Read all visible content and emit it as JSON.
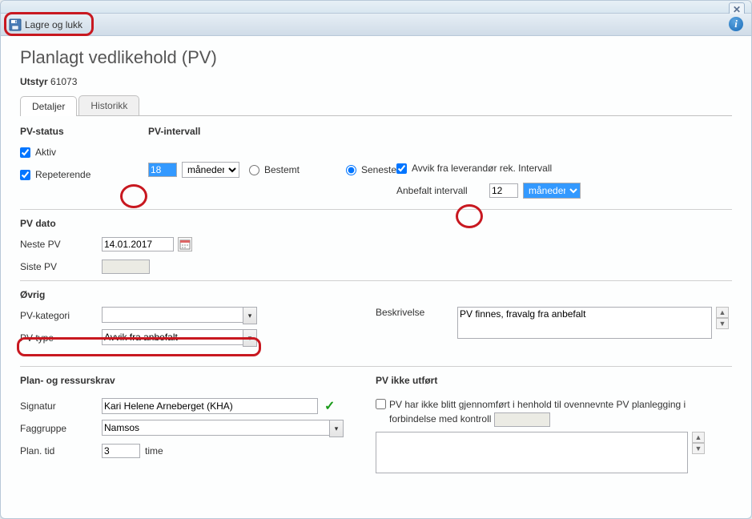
{
  "window": {
    "title": ""
  },
  "toolbar": {
    "save_label": "Lagre og lukk"
  },
  "page": {
    "heading": "Planlagt vedlikehold (PV)",
    "equipment_label": "Utstyr",
    "equipment_id": "61073"
  },
  "tabs": {
    "details": "Detaljer",
    "history": "Historikk"
  },
  "status": {
    "section": "PV-status",
    "active_label": "Aktiv",
    "active_checked": "checked",
    "repeating_label": "Repeterende",
    "repeating_checked": "checked"
  },
  "interval": {
    "section": "PV-intervall",
    "value": "18",
    "unit_options": "måneder",
    "fixed_label": "Bestemt",
    "latest_label": "Seneste",
    "deviation_label": "Avvik fra leverandør rek. Intervall",
    "deviation_checked": "checked",
    "recommended_label": "Anbefalt intervall",
    "recommended_value": "12",
    "recommended_unit": "måneder"
  },
  "pvdate": {
    "section": "PV dato",
    "next_label": "Neste PV",
    "next_value": "14.01.2017",
    "last_label": "Siste PV",
    "last_value": ""
  },
  "other": {
    "section": "Øvrig",
    "category_label": "PV-kategori",
    "category_value": "",
    "type_label": "PV-type",
    "type_value": "Avvik fra anbefalt",
    "description_label": "Beskrivelse",
    "description_value": "PV finnes, fravalg fra anbefalt"
  },
  "plan": {
    "section": "Plan- og ressurskrav",
    "signature_label": "Signatur",
    "signature_value": "Kari Helene Arneberget (KHA)",
    "group_label": "Faggruppe",
    "group_value": "Namsos",
    "time_label": "Plan. tid",
    "time_value": "3",
    "time_unit": "time"
  },
  "notdone": {
    "section": "PV ikke utført",
    "cb_label_1": "PV har ikke blitt gjennomført i henhold til ovennevnte PV planlegging i forbindelse med kontroll",
    "cb_checked": "",
    "control_value": "",
    "notes": ""
  }
}
